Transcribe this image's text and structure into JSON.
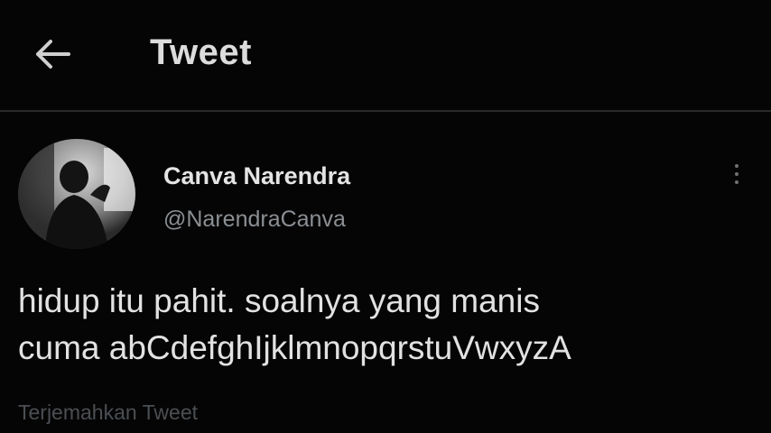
{
  "header": {
    "title": "Tweet"
  },
  "tweet": {
    "author_name": "Canva Narendra",
    "author_handle": "@NarendraCanva",
    "text": "hidup itu pahit. soalnya yang manis\ncuma abCdefghIjklmnopqrstuVwxyzA",
    "translate_label": "Terjemahkan Tweet"
  },
  "icons": {
    "back": "back-arrow-icon",
    "more": "more-vertical-icon",
    "avatar": "avatar-photo"
  },
  "colors": {
    "background": "#000000",
    "primary_text": "#e7e9ea",
    "secondary_text": "#8b8f93",
    "divider": "#2a2a2a"
  }
}
